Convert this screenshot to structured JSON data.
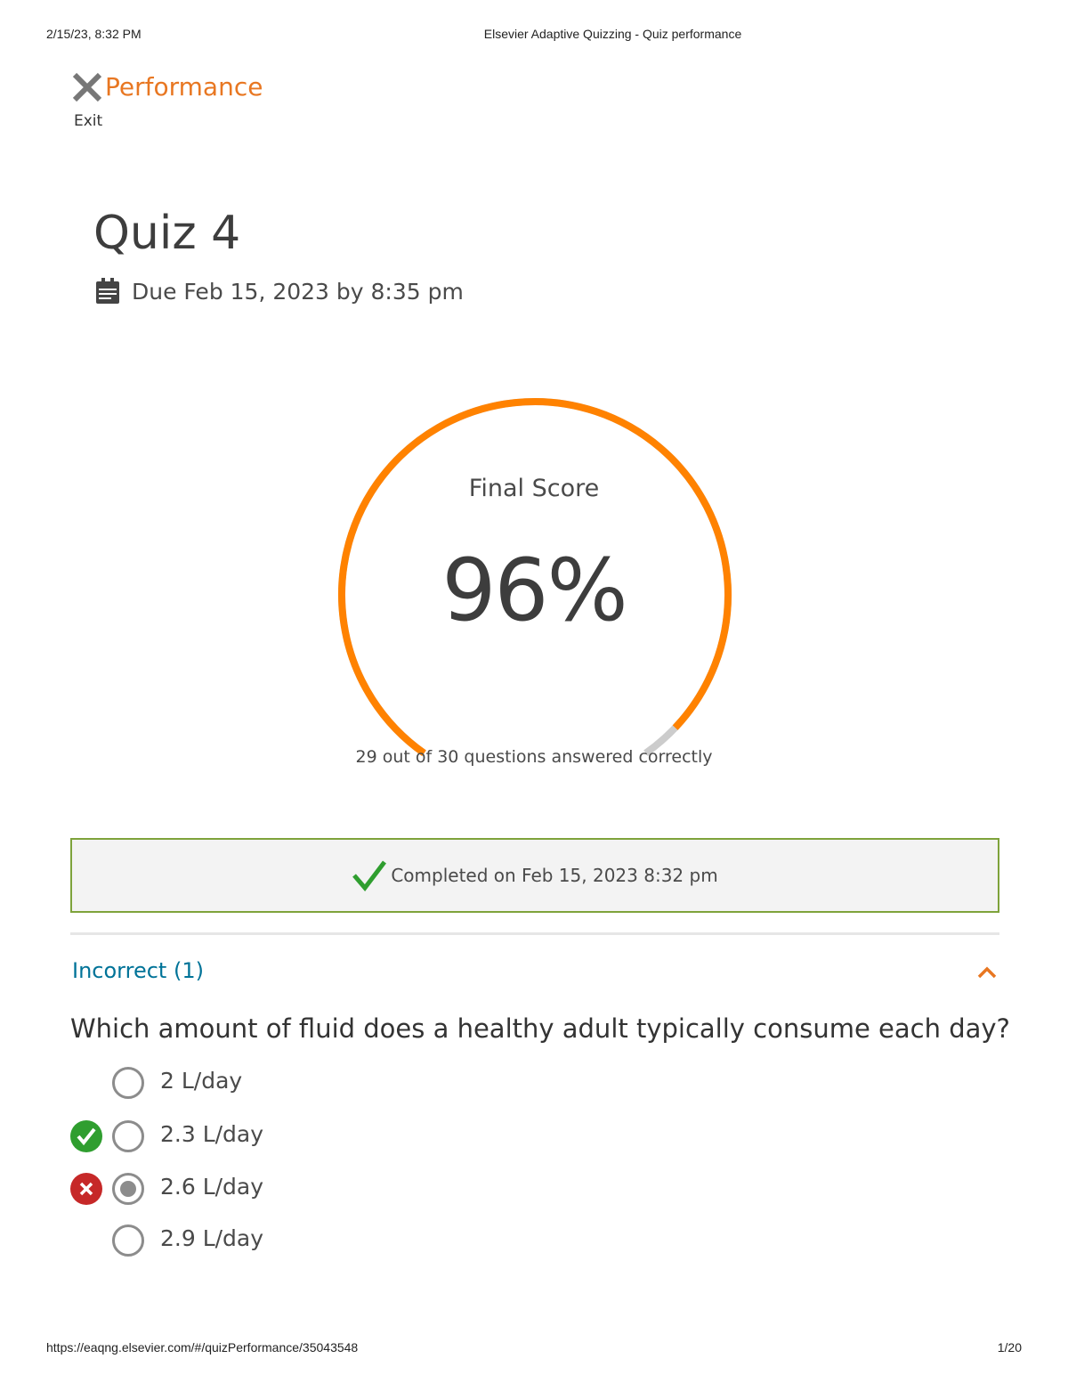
{
  "print": {
    "datetime": "2/15/23, 8:32 PM",
    "doc_title": "Elsevier Adaptive Quizzing - Quiz performance",
    "url": "https://eaqng.elsevier.com/#/quizPerformance/35043548",
    "page": "1/20"
  },
  "header": {
    "exit_label": "Exit",
    "exit_icon": "close-icon",
    "title": "Performance",
    "accent_color": "#e87722"
  },
  "quiz": {
    "title": "Quiz 4",
    "due_icon": "calendar-icon",
    "due": "Due Feb 15, 2023 by 8:35 pm"
  },
  "score": {
    "label": "Final Score",
    "value": "96%",
    "fraction": 0.96,
    "summary": "29 out of 30 questions answered correctly",
    "arc_color": "#ff8200",
    "remaining_color": "#cccccc"
  },
  "completion": {
    "icon": "checkmark-icon",
    "text": "Completed on Feb 15, 2023 8:32 pm",
    "border_color": "#7ea33b"
  },
  "incorrect_section": {
    "title": "Incorrect (1)",
    "toggle_icon": "chevron-up-icon",
    "question": "Which amount of fluid does a healthy adult typically consume each day?",
    "options": [
      {
        "label": "2 L/day",
        "status": "none",
        "selected": false
      },
      {
        "label": "2.3 L/day",
        "status": "correct",
        "selected": false
      },
      {
        "label": "2.6 L/day",
        "status": "incorrect",
        "selected": true
      },
      {
        "label": "2.9 L/day",
        "status": "none",
        "selected": false
      }
    ]
  }
}
